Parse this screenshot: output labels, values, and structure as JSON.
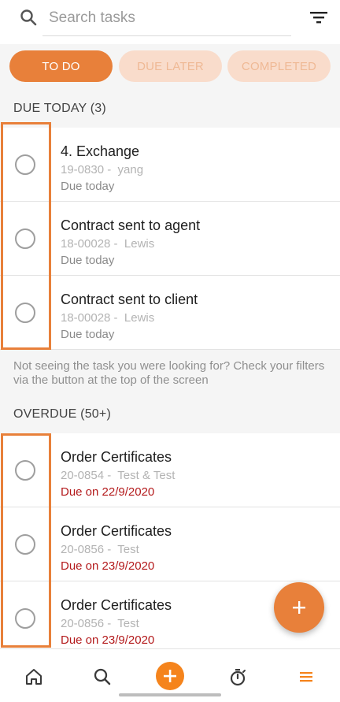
{
  "search": {
    "placeholder": "Search tasks",
    "icon": "search-icon",
    "filter_icon": "filter-icon"
  },
  "tabs": [
    {
      "label": "TO DO",
      "active": true
    },
    {
      "label": "DUE LATER",
      "active": false
    },
    {
      "label": "COMPLETED",
      "active": false
    }
  ],
  "due_today": {
    "header": "DUE TODAY (3)",
    "tasks": [
      {
        "title": "4. Exchange",
        "meta": "19-0830 -  yang",
        "due": "Due today"
      },
      {
        "title": "Contract sent to agent",
        "meta": "18-00028 -  Lewis",
        "due": "Due today"
      },
      {
        "title": "Contract sent to client",
        "meta": "18-00028 -  Lewis",
        "due": "Due today"
      }
    ]
  },
  "hint": "Not seeing the task you were looking for? Check your filters via the button at the top of the screen",
  "overdue": {
    "header": "OVERDUE (50+)",
    "tasks": [
      {
        "title": "Order Certificates",
        "meta": "20-0854 -  Test & Test",
        "due": "Due on 22/9/2020"
      },
      {
        "title": "Order Certificates",
        "meta": "20-0856 -  Test",
        "due": "Due on 23/9/2020"
      },
      {
        "title": "Order Certificates",
        "meta": "20-0856 -  Test",
        "due": "Due on 23/9/2020"
      }
    ]
  },
  "fab": {
    "icon": "plus-icon"
  },
  "bottom_nav": [
    {
      "name": "home",
      "icon": "home-icon"
    },
    {
      "name": "search",
      "icon": "search-icon"
    },
    {
      "name": "add",
      "icon": "plus-icon"
    },
    {
      "name": "timer",
      "icon": "stopwatch-icon"
    },
    {
      "name": "menu",
      "icon": "menu-icon"
    }
  ],
  "colors": {
    "accent": "#e8803a",
    "tab_inactive_bg": "#f9dccb",
    "overdue_text": "#b3191b",
    "nav_add": "#f5841c"
  }
}
